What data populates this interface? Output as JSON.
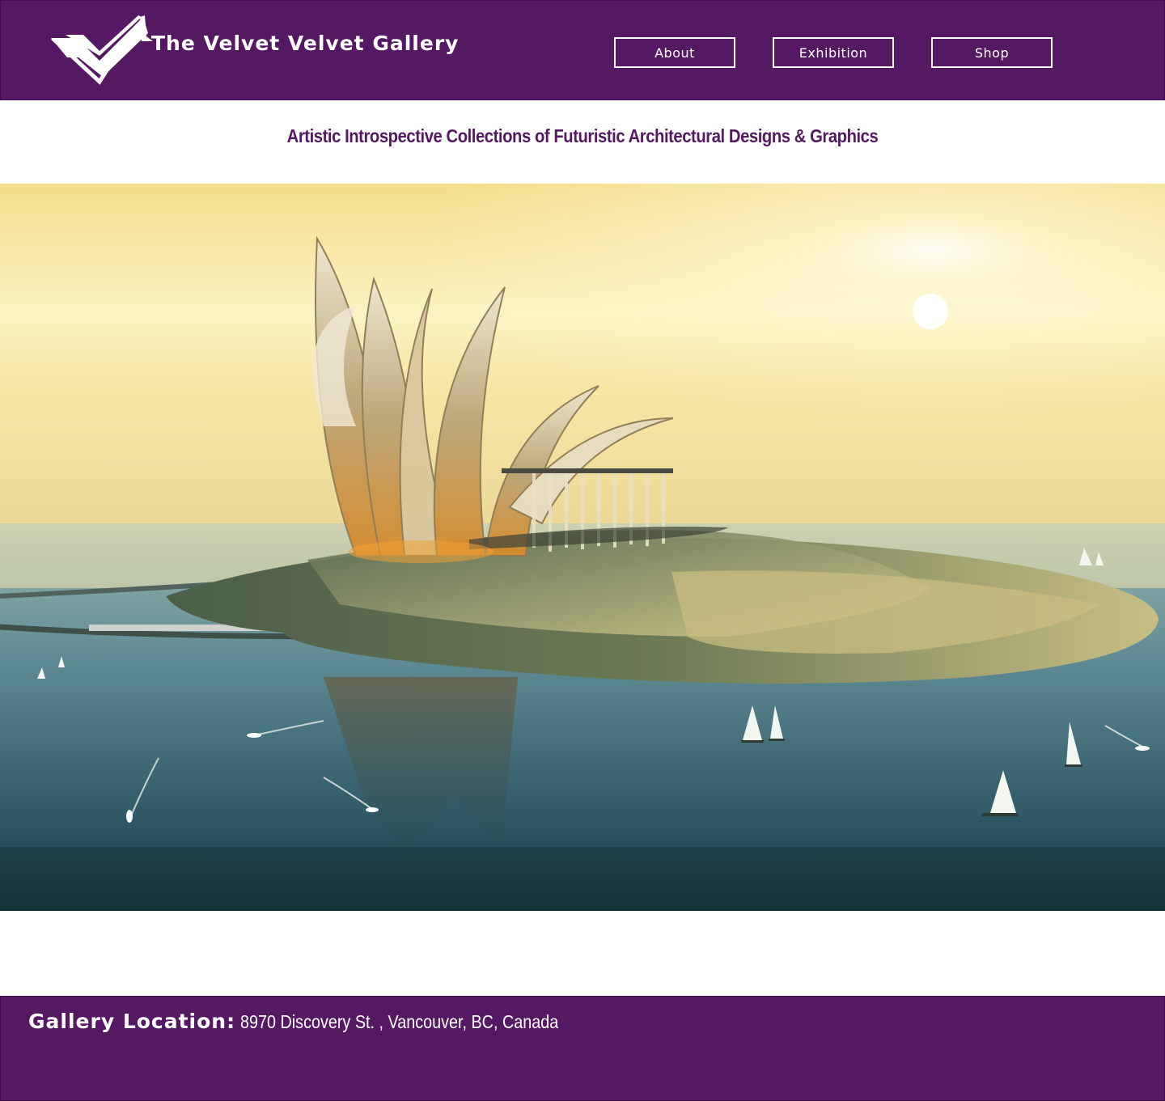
{
  "header": {
    "title": "The Velvet Velvet Gallery",
    "logo_icon": "velvet-v-logo-icon",
    "nav": [
      {
        "label": "About"
      },
      {
        "label": "Exhibition"
      },
      {
        "label": "Shop"
      }
    ]
  },
  "tagline": "Artistic Introspective Collections of Futuristic Architectural Designs & Graphics",
  "hero": {
    "image": "futuristic-island-architecture-illustration"
  },
  "footer": {
    "location_label": "Gallery Location:",
    "address": "8970 Discovery St. , Vancouver, BC, Canada"
  },
  "colors": {
    "brand_purple": "#551863",
    "text_on_brand": "#ffffff"
  }
}
